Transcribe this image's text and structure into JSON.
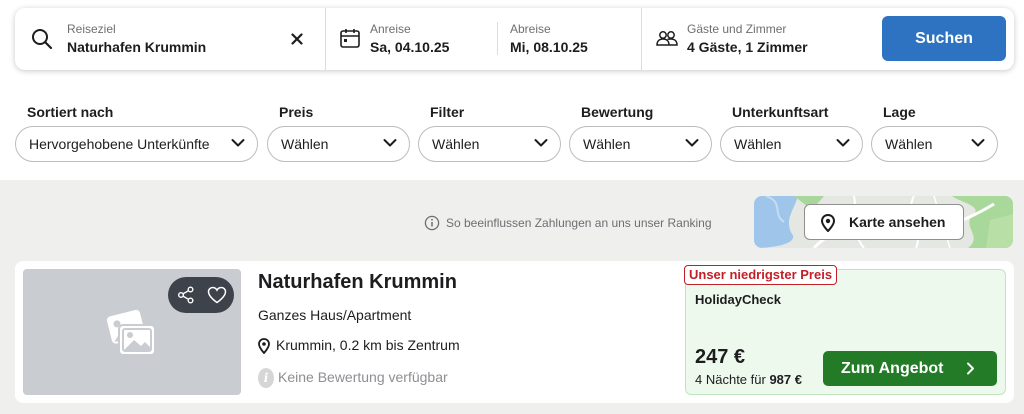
{
  "search": {
    "destination": {
      "label": "Reiseziel",
      "value": "Naturhafen Krummin"
    },
    "arrival": {
      "label": "Anreise",
      "value": "Sa, 04.10.25"
    },
    "departure": {
      "label": "Abreise",
      "value": "Mi, 08.10.25"
    },
    "guests": {
      "label": "Gäste und Zimmer",
      "value": "4 Gäste, 1 Zimmer"
    },
    "button_label": "Suchen"
  },
  "filters": [
    {
      "title": "Sortiert nach",
      "value": "Hervorgehobene Unterkünfte"
    },
    {
      "title": "Preis",
      "value": "Wählen"
    },
    {
      "title": "Filter",
      "value": "Wählen"
    },
    {
      "title": "Bewertung",
      "value": "Wählen"
    },
    {
      "title": "Unterkunftsart",
      "value": "Wählen"
    },
    {
      "title": "Lage",
      "value": "Wählen"
    }
  ],
  "ranking_note": "So beeinflussen Zahlungen an uns unser Ranking",
  "map": {
    "button_label": "Karte ansehen"
  },
  "hotel": {
    "name": "Naturhafen Krummin",
    "type": "Ganzes Haus/Apartment",
    "location": "Krummin, 0.2 km bis Zentrum",
    "rating_icon": "i",
    "rating_text": "Keine Bewertung verfügbar",
    "offer": {
      "badge": "Unser niedrigster Preis",
      "provider": "HolidayCheck",
      "price": "247 €",
      "total_prefix": "4 Nächte für",
      "total_value": "987 €",
      "button_label": "Zum Angebot"
    }
  },
  "colors": {
    "primary_blue": "#2e73c1",
    "offer_green": "#237a27",
    "badge_red": "#c21f27",
    "offer_background": "#eef9ee"
  }
}
